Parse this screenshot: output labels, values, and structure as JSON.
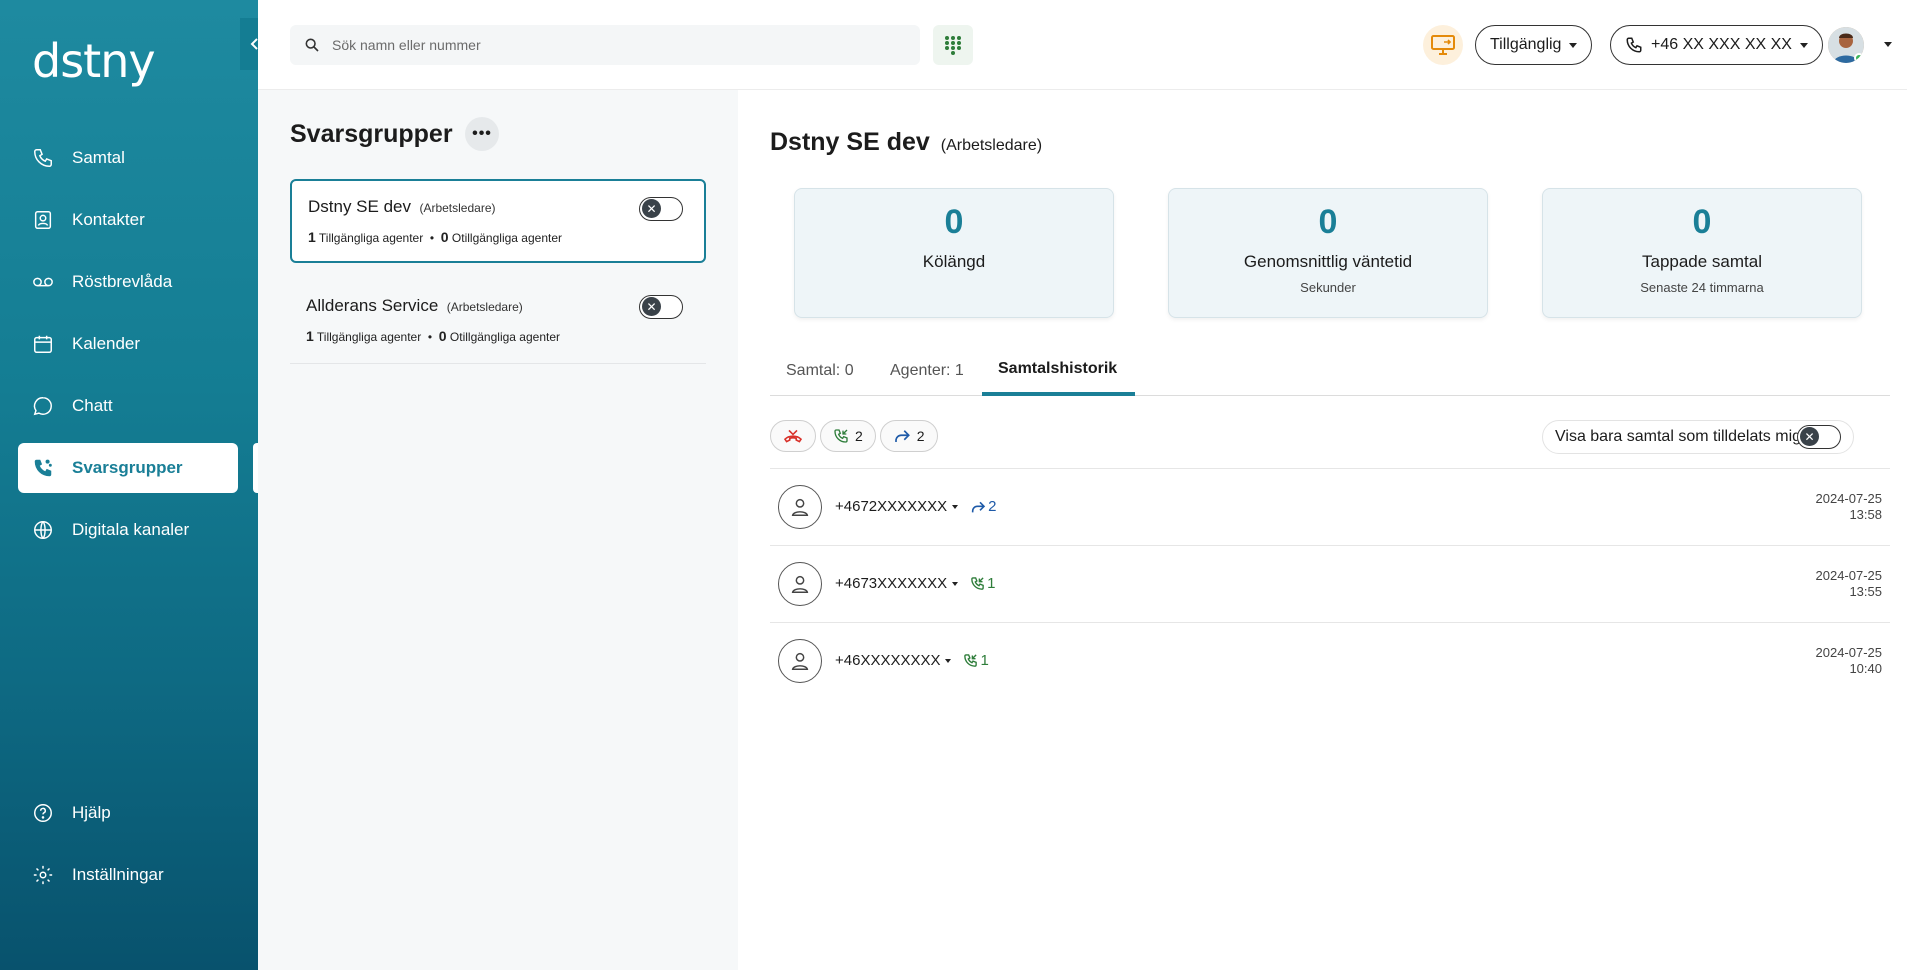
{
  "sidebar": {
    "logo": "dstny",
    "items": [
      {
        "label": "Samtal",
        "icon": "phone-icon"
      },
      {
        "label": "Kontakter",
        "icon": "contact-icon"
      },
      {
        "label": "Röstbrevlåda",
        "icon": "voicemail-icon"
      },
      {
        "label": "Kalender",
        "icon": "calendar-icon"
      },
      {
        "label": "Chatt",
        "icon": "chat-icon"
      },
      {
        "label": "Svarsgrupper",
        "icon": "group-phone-icon",
        "active": true
      },
      {
        "label": "Digitala kanaler",
        "icon": "globe-icon"
      }
    ],
    "bottom_items": [
      {
        "label": "Hjälp",
        "icon": "help-icon"
      },
      {
        "label": "Inställningar",
        "icon": "gear-icon"
      }
    ]
  },
  "topbar": {
    "search_placeholder": "Sök namn eller nummer",
    "status": "Tillgänglig",
    "phone_number": "+46 XX XXX XX XX"
  },
  "groups": {
    "title": "Svarsgrupper",
    "list": [
      {
        "name": "Dstny SE dev",
        "role": "(Arbetsledare)",
        "available_count": "1",
        "available_label": "Tillgängliga agenter",
        "unavailable_count": "0",
        "unavailable_label": "Otillgängliga agenter",
        "selected": true
      },
      {
        "name": "Allderans Service",
        "role": "(Arbetsledare)",
        "available_count": "1",
        "available_label": "Tillgängliga agenter",
        "unavailable_count": "0",
        "unavailable_label": "Otillgängliga agenter",
        "selected": false
      }
    ]
  },
  "detail": {
    "title": "Dstny SE dev",
    "role": "(Arbetsledare)",
    "stats": [
      {
        "value": "0",
        "label": "Kölängd",
        "sub": ""
      },
      {
        "value": "0",
        "label": "Genomsnittlig väntetid",
        "sub": "Sekunder"
      },
      {
        "value": "0",
        "label": "Tappade samtal",
        "sub": "Senaste 24 timmarna"
      }
    ],
    "tabs": [
      {
        "label": "Samtal: 0"
      },
      {
        "label": "Agenter: 1"
      },
      {
        "label": "Samtalshistorik",
        "active": true
      }
    ],
    "filters": {
      "answered_count": "2",
      "forwarded_count": "2",
      "assigned_only_label": "Visa bara samtal som tilldelats mig"
    },
    "calls": [
      {
        "number": "+4672XXXXXXX",
        "badge_type": "forwarded",
        "badge_count": "2",
        "date": "2024-07-25",
        "time": "13:58"
      },
      {
        "number": "+4673XXXXXXX",
        "badge_type": "answered",
        "badge_count": "1",
        "date": "2024-07-25",
        "time": "13:55"
      },
      {
        "number": "+46XXXXXXXX",
        "badge_type": "answered",
        "badge_count": "1",
        "date": "2024-07-25",
        "time": "10:40"
      }
    ]
  },
  "colors": {
    "brand": "#1a7f97",
    "missed": "#d9322b",
    "answered": "#2e7d3a",
    "forwarded": "#1e5aa8"
  }
}
